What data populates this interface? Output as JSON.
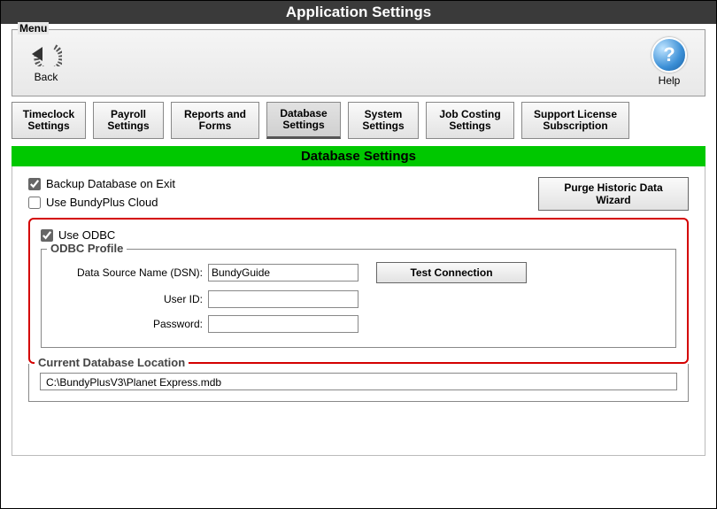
{
  "title": "Application Settings",
  "menu": {
    "legend": "Menu",
    "back": "Back",
    "help": "Help"
  },
  "tabs": [
    "Timeclock Settings",
    "Payroll Settings",
    "Reports and Forms",
    "Database Settings",
    "System Settings",
    "Job Costing Settings",
    "Support License Subscription"
  ],
  "section_title": "Database Settings",
  "options": {
    "backup_on_exit": "Backup Database on Exit",
    "use_cloud": "Use BundyPlus Cloud",
    "purge_btn": "Purge Historic Data Wizard",
    "use_odbc": "Use ODBC"
  },
  "odbc": {
    "legend": "ODBC Profile",
    "dsn_label": "Data Source Name (DSN):",
    "dsn_value": "BundyGuide",
    "user_label": "User ID:",
    "user_value": "",
    "pass_label": "Password:",
    "pass_value": "",
    "test_btn": "Test Connection"
  },
  "db_location": {
    "legend": "Current Database Location",
    "path": "C:\\BundyPlusV3\\Planet Express.mdb"
  }
}
